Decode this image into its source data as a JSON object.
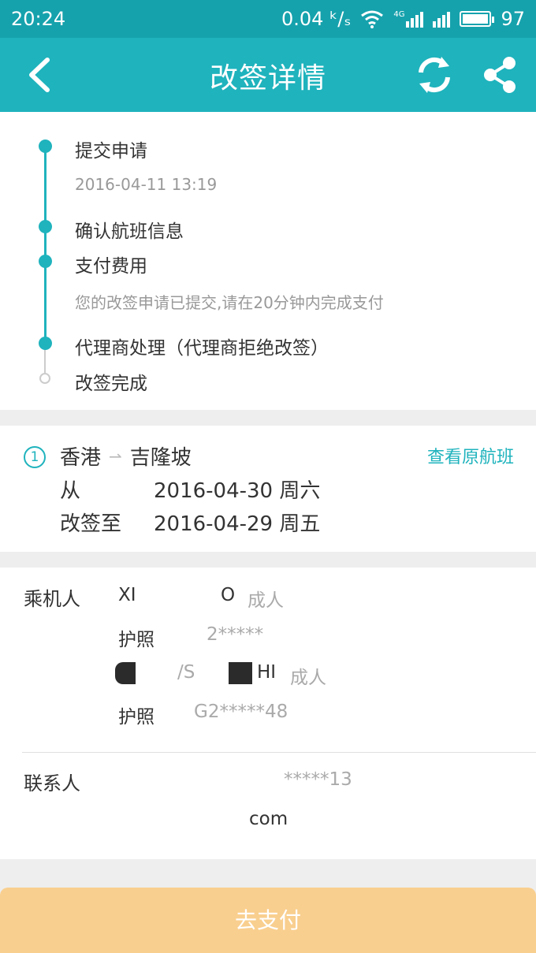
{
  "status_bar": {
    "time": "20:24",
    "speed": "0.04 ᵏ/ₛ",
    "network": "4G",
    "battery": "97"
  },
  "header": {
    "title": "改签详情"
  },
  "timeline": {
    "steps": [
      {
        "label": "提交申请",
        "sub": "2016-04-11 13:19"
      },
      {
        "label": "确认航班信息"
      },
      {
        "label": "支付费用",
        "sub": "您的改签申请已提交,请在20分钟内完成支付"
      },
      {
        "label": "代理商处理（代理商拒绝改签）"
      },
      {
        "label": "改签完成"
      }
    ]
  },
  "flight": {
    "index": "1",
    "from_city": "香港",
    "arrow": "⇀",
    "to_city": "吉隆坡",
    "view_original": "查看原航班",
    "from_label": "从",
    "from_date": "2016-04-30  周六",
    "to_label": "改签至",
    "to_date": "2016-04-29  周五"
  },
  "passengers": {
    "section_label": "乘机人",
    "list": [
      {
        "name_start": "XI",
        "name_end": "O",
        "type": "成人",
        "doc_label": "护照",
        "doc_number": "2*****"
      },
      {
        "name_start": "",
        "name_mid": "/S",
        "name_end": "HI",
        "type": "成人",
        "doc_label": "护照",
        "doc_number": "G2*****48"
      }
    ]
  },
  "contact": {
    "section_label": "联系人",
    "phone": "*****13",
    "email": "com"
  },
  "pay_button": {
    "label": "去支付"
  }
}
